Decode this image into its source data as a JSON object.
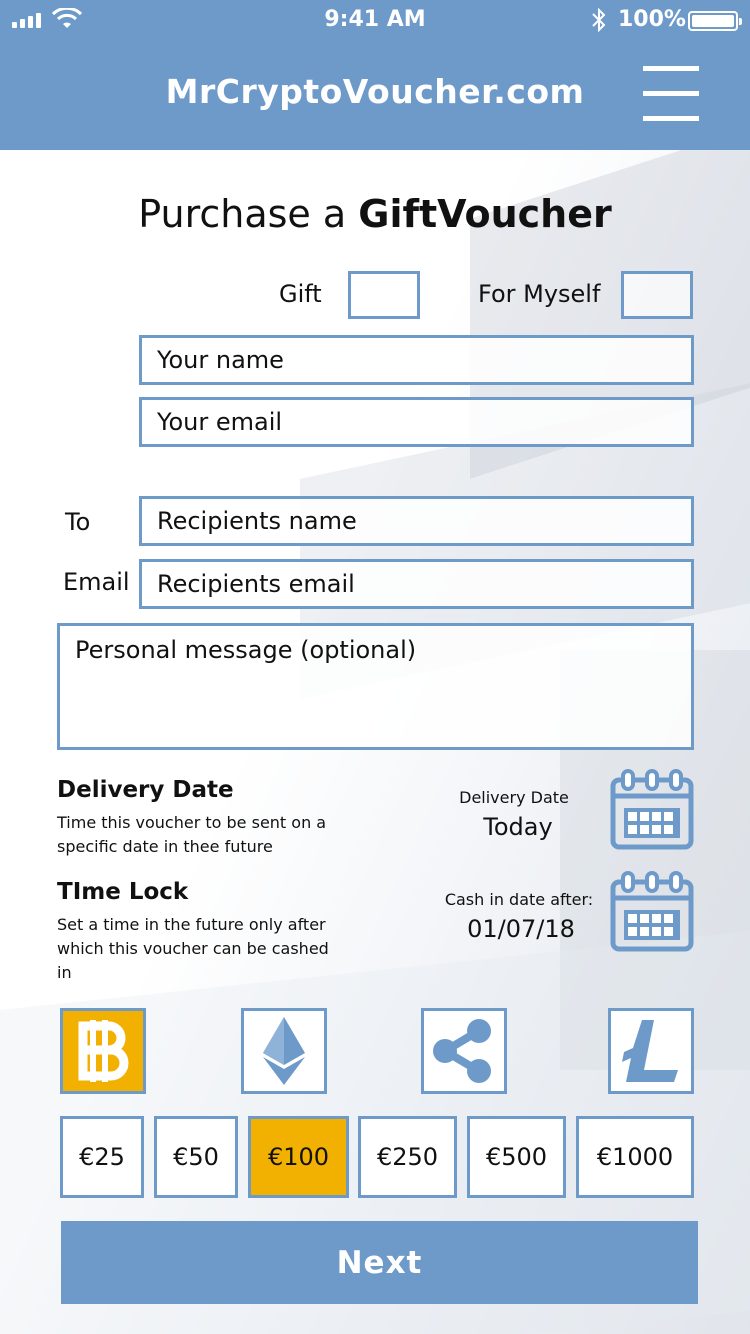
{
  "status_bar": {
    "time": "9:41 AM",
    "battery": "100%"
  },
  "header": {
    "site_title": "MrCryptoVoucher.com",
    "menu_icon": "hamburger-menu-icon"
  },
  "page": {
    "title_prefix": "Purchase a ",
    "title_bold": "GiftVoucher"
  },
  "form": {
    "gift_label": "Gift",
    "for_myself_label": "For Myself",
    "your_name_placeholder": "Your name",
    "your_email_placeholder": "Your email",
    "to_label": "To",
    "recipient_name_placeholder": "Recipients name",
    "email_label": "Email",
    "recipient_email_placeholder": "Recipients email",
    "message_placeholder": "Personal message (optional)"
  },
  "delivery": {
    "title": "Delivery Date",
    "description": "Time this voucher to be sent on a specific date in thee future",
    "label": "Delivery Date",
    "value": "Today"
  },
  "time_lock": {
    "title": "TIme Lock",
    "description": "Set a time in the future only after which this voucher can be cashed in",
    "label": "Cash in date after:",
    "value": "01/07/18"
  },
  "currencies": [
    {
      "name": "bitcoin-icon",
      "selected": true
    },
    {
      "name": "ethereum-icon",
      "selected": false
    },
    {
      "name": "ripple-icon",
      "selected": false
    },
    {
      "name": "litecoin-icon",
      "selected": false
    }
  ],
  "amounts": [
    "€25",
    "€50",
    "€100",
    "€250",
    "€500",
    "€1000"
  ],
  "selected_amount": "€100",
  "next_label": "Next",
  "colors": {
    "accent": "#6e9ac9",
    "selected": "#f2b100"
  }
}
